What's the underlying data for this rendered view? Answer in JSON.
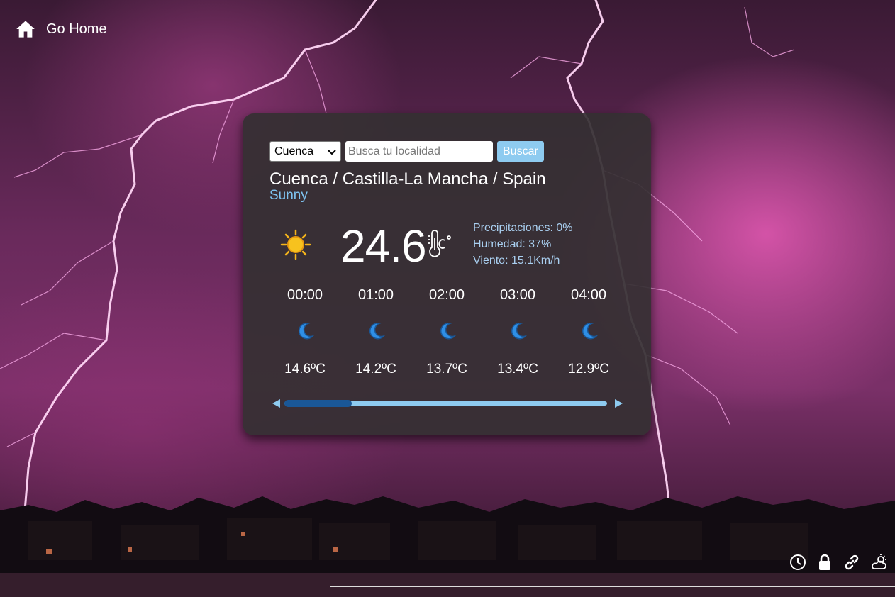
{
  "nav": {
    "home_label": "Go Home",
    "home_icon": "home-icon"
  },
  "search": {
    "selected_location": "Cuenca",
    "placeholder": "Busca tu localidad",
    "button_label": "Buscar"
  },
  "current": {
    "location": "Cuenca / Castilla-La Mancha / Spain",
    "condition": "Sunny",
    "temperature": "24.6",
    "weather_icon": "sun-icon",
    "precipitation": "Precipitaciones: 0%",
    "humidity": "Humedad: 37%",
    "wind": "Viento: 15.1Km/h"
  },
  "hourly": [
    {
      "time": "00:00",
      "icon": "moon-icon",
      "temp": "14.6ºC"
    },
    {
      "time": "01:00",
      "icon": "moon-icon",
      "temp": "14.2ºC"
    },
    {
      "time": "02:00",
      "icon": "moon-icon",
      "temp": "13.7ºC"
    },
    {
      "time": "03:00",
      "icon": "moon-icon",
      "temp": "13.4ºC"
    },
    {
      "time": "04:00",
      "icon": "moon-icon",
      "temp": "12.9ºC"
    }
  ],
  "scroll_position": 0.2,
  "footer_icons": [
    "clock-icon",
    "lock-icon",
    "link-icon",
    "cloudy-sun-icon"
  ],
  "colors": {
    "accent": "#8ecbf0",
    "thumb": "#1a5797",
    "card": "#343032"
  }
}
